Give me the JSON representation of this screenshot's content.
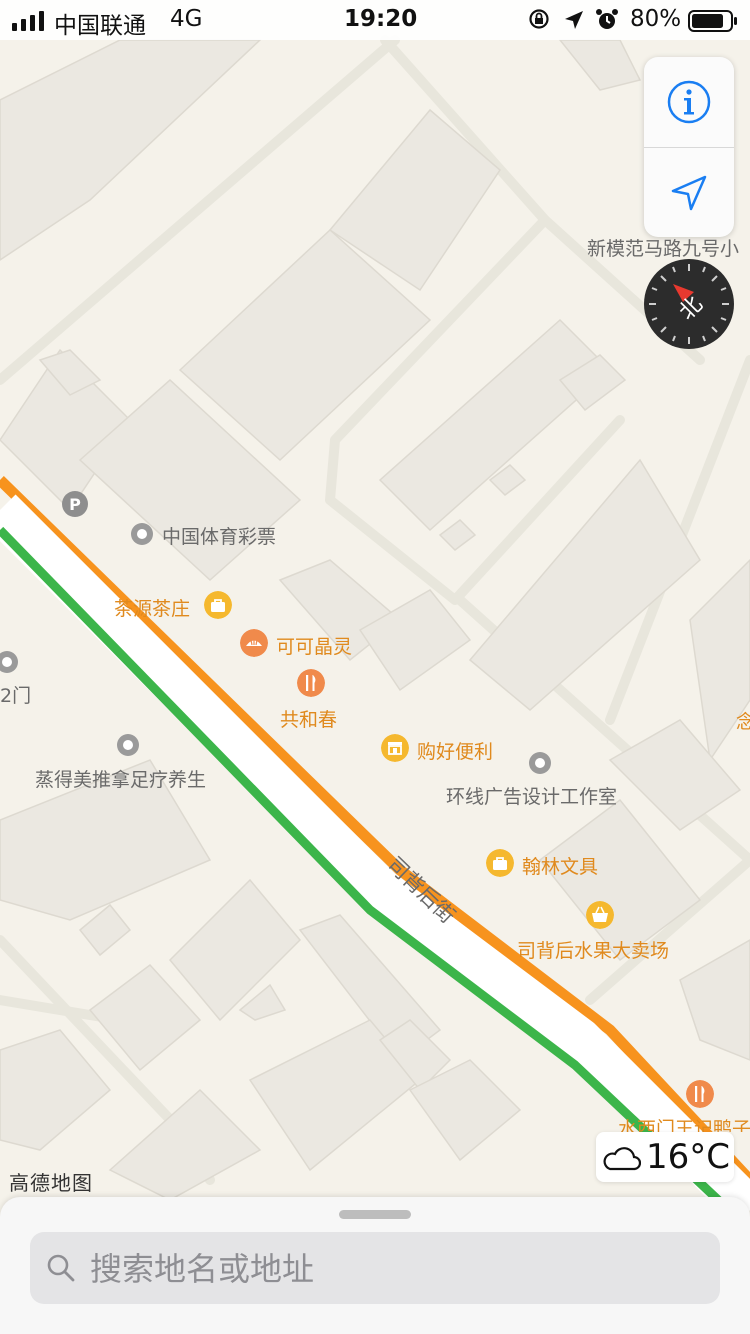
{
  "status_bar": {
    "carrier": "中国联通",
    "network": "4G",
    "time": "19:20",
    "battery": "80%"
  },
  "map": {
    "street_name": "司背后街",
    "watermark": "高德地图",
    "compass_label": "北",
    "region_label": "新模范马路九号小",
    "pois": [
      {
        "name": "中国体育彩票",
        "icon": "place-dot-icon",
        "style": "gray"
      },
      {
        "name": "茶源茶庄",
        "icon": "shopping-bag-icon",
        "style": "orange"
      },
      {
        "name": "可可晶灵",
        "icon": "bakery-icon",
        "style": "orange"
      },
      {
        "name": "共和春",
        "icon": "restaurant-icon",
        "style": "orange"
      },
      {
        "name": "购好便利",
        "icon": "store-icon",
        "style": "orange"
      },
      {
        "name": "环线广告设计工作室",
        "icon": "place-dot-icon",
        "style": "gray"
      },
      {
        "name": "翰林文具",
        "icon": "shopping-bag-icon",
        "style": "orange"
      },
      {
        "name": "司背后水果大卖场",
        "icon": "basket-icon",
        "style": "orange"
      },
      {
        "name": "蒸得美推拿足疗养生",
        "icon": "place-dot-icon",
        "style": "gray"
      },
      {
        "name": "水西门王记鸭子",
        "icon": "restaurant-icon",
        "style": "orange"
      },
      {
        "name": "2门",
        "icon": "place-dot-icon",
        "style": "gray"
      },
      {
        "name": "念",
        "icon": "",
        "style": "orange"
      }
    ],
    "parking_label": "P"
  },
  "controls": {
    "info_icon": "info-icon",
    "locate_icon": "location-arrow-icon"
  },
  "weather": {
    "icon": "cloud-icon",
    "temperature": "16°C"
  },
  "search": {
    "placeholder": "搜索地名或地址"
  },
  "colors": {
    "map_bg": "#f5f2ea",
    "road_white": "#ffffff",
    "traffic_orange": "#f7931e",
    "traffic_green": "#3cb54a",
    "poi_orange": "#e08a1e",
    "ios_blue": "#1a7ef2"
  }
}
